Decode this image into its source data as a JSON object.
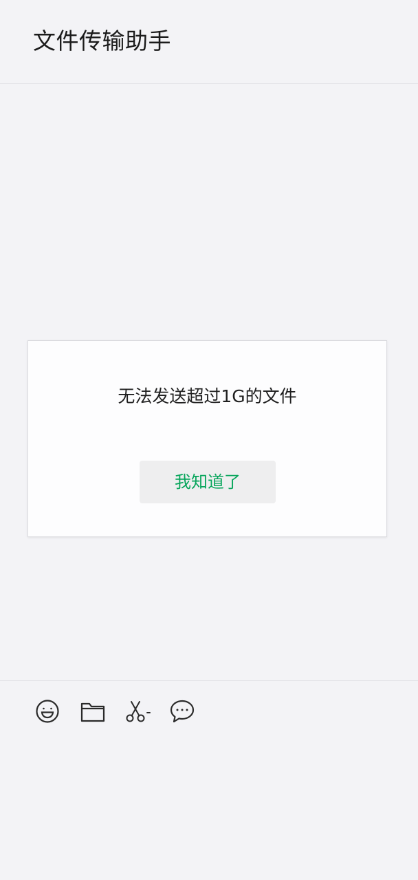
{
  "header": {
    "title": "文件传输助手"
  },
  "dialog": {
    "message": "无法发送超过1G的文件",
    "confirm_label": "我知道了"
  },
  "toolbar": {
    "items": [
      {
        "icon": "emoji-icon"
      },
      {
        "icon": "folder-icon"
      },
      {
        "icon": "scissors-icon"
      },
      {
        "icon": "chat-bubble-icon"
      }
    ]
  },
  "colors": {
    "background": "#f3f3f6",
    "dialog_background": "#fdfdfe",
    "button_background": "#eeeeef",
    "accent_green": "#07a55b",
    "text": "#1f1f1f"
  }
}
